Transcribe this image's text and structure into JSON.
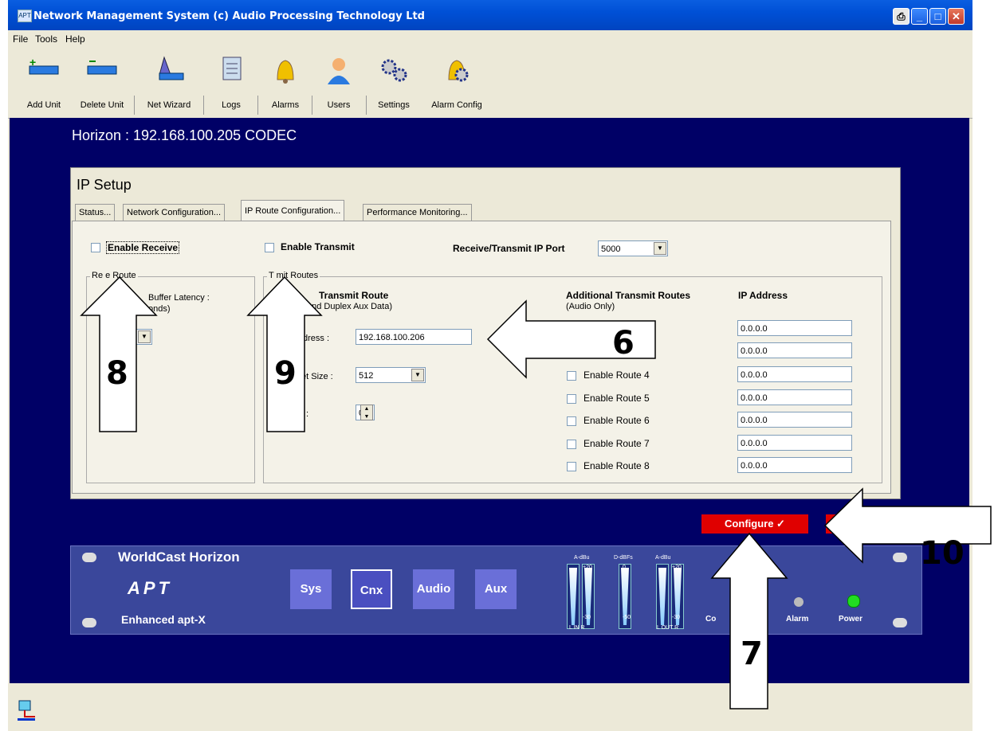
{
  "window": {
    "title": "Network Management System  (c) Audio Processing Technology Ltd",
    "app_icon": "APT"
  },
  "menu": [
    "File",
    "Tools",
    "Help"
  ],
  "toolbar": [
    {
      "label": "Add Unit",
      "icon": "add-unit-icon"
    },
    {
      "label": "Delete Unit",
      "icon": "delete-unit-icon"
    },
    {
      "label": "Net Wizard",
      "icon": "wizard-icon"
    },
    {
      "label": "Logs",
      "icon": "logs-icon"
    },
    {
      "label": "Alarms",
      "icon": "bell-icon"
    },
    {
      "label": "Users",
      "icon": "user-icon"
    },
    {
      "label": "Settings",
      "icon": "gears-icon"
    },
    {
      "label": "Alarm Config",
      "icon": "alarm-config-icon"
    }
  ],
  "device_title": "Horizon : 192.168.100.205 CODEC",
  "panel": {
    "title": "IP Setup",
    "tabs": [
      "Status...",
      "Network Configuration...",
      "IP Route Configuration...",
      "Performance Monitoring..."
    ],
    "active_tab": 2,
    "enable_receive": "Enable Receive",
    "enable_transmit": "Enable Transmit",
    "port_label": "Receive/Transmit IP Port",
    "port_value": "5000",
    "receive_group": "Re     e Route",
    "receive_latency": "Buffer Latency :",
    "receive_latency_unit": "onds)",
    "transmit_group": "T      mit Routes",
    "transmit_route_title": "Transmit Route",
    "transmit_route_sub": "and Duplex Aux Data)",
    "ip_label": "dress :",
    "ip_value": "192.168.100.206",
    "packet_label": "et Size :",
    "packet_value": "512",
    "third_label": ":",
    "third_value": "0",
    "additional_title": "Additional Transmit Routes",
    "additional_sub": "(Audio Only)",
    "ip_col": "IP Address",
    "routes": [
      {
        "label": "",
        "ip": "0.0.0.0"
      },
      {
        "label": "",
        "ip": "0.0.0.0"
      },
      {
        "label": "Enable Route 4",
        "ip": "0.0.0.0"
      },
      {
        "label": "Enable Route 5",
        "ip": "0.0.0.0"
      },
      {
        "label": "Enable Route 6",
        "ip": "0.0.0.0"
      },
      {
        "label": "Enable Route 7",
        "ip": "0.0.0.0"
      },
      {
        "label": "Enable Route 8",
        "ip": "0.0.0.0"
      }
    ]
  },
  "configure_label": "Configure ✓",
  "device": {
    "name": "WorldCast Horizon",
    "brand": "APT",
    "subtitle": "Enhanced apt-X",
    "buttons": [
      "Sys",
      "Cnx",
      "Audio",
      "Aux"
    ],
    "meter_in_label": "A-dBu",
    "meter_mid_label": "D-dBFs",
    "meter_out_label": "A-dBu",
    "meter_in_foot": "L  IN  R",
    "meter_out_foot": "L  OUT  R",
    "meter_in_top": "+20",
    "meter_mid_top": "0",
    "meter_out_top": "+20",
    "meter_in_bottom": "-30",
    "meter_mid_bottom": "-50",
    "meter_out_bottom": "-30",
    "con_label": "Co",
    "alarm_label": "Alarm",
    "power_label": "Power"
  },
  "callouts": [
    "6",
    "7",
    "8",
    "9",
    "10"
  ],
  "colors": {
    "main_bg": "#000066",
    "configure": "#e00000",
    "titlebar": "#0050d6",
    "power_led": "#22dd22"
  }
}
